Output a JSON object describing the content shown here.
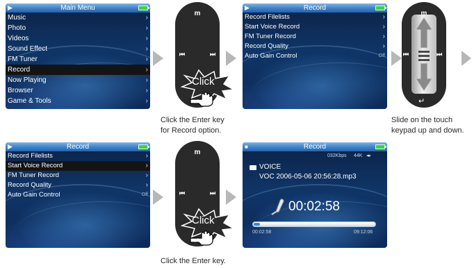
{
  "screen1": {
    "title": "Main Menu",
    "play_icon": "▶",
    "items": [
      {
        "label": "Music"
      },
      {
        "label": "Photo"
      },
      {
        "label": "Videos"
      },
      {
        "label": "Sound Effect"
      },
      {
        "label": "FM Tuner"
      },
      {
        "label": "Record"
      },
      {
        "label": "Now Playing"
      },
      {
        "label": "Browser"
      },
      {
        "label": "Game & Tools"
      }
    ],
    "selected_index": 5,
    "chevron": "›"
  },
  "screen2": {
    "title": "Record",
    "play_icon": "▶",
    "items": [
      {
        "label": "Record Filelists",
        "value": "›"
      },
      {
        "label": "Start Voice Record",
        "value": "›"
      },
      {
        "label": "FM Tuner Record",
        "value": "›"
      },
      {
        "label": "Record Quality",
        "value": "›"
      },
      {
        "label": "Auto Gain Control",
        "value": "Off"
      }
    ]
  },
  "screen3": {
    "title": "Record",
    "play_icon": "▶",
    "items": [
      {
        "label": "Record Filelists",
        "value": "›"
      },
      {
        "label": "Start Voice Record",
        "value": "›"
      },
      {
        "label": "FM Tuner Record",
        "value": "›"
      },
      {
        "label": "Record Quality",
        "value": "›"
      },
      {
        "label": "Auto Gain Control",
        "value": "Off"
      }
    ],
    "selected_index": 1
  },
  "screen4": {
    "title": "Record",
    "stop_icon": "■",
    "bitrate": "032Kbps",
    "sample_rate": "44K",
    "folder": "VOICE",
    "filename": "VOC 2006-05-06 20:56:28.mp3",
    "elapsed": "00:02:58",
    "elapsed_small": "00:02:58",
    "total": "09:12:06",
    "progress_fraction": 0.05
  },
  "remote": {
    "top_label": "m",
    "left_label": "⏮",
    "right_label": "⏭",
    "enter_glyph": "↵",
    "click_label": "Click"
  },
  "captions": {
    "enter_record": "Click the Enter key\nfor Record option.",
    "slide": "Slide on the touch\nkeypad up and down.",
    "enter": "Click the Enter key."
  },
  "colors": {
    "arrow": "#b7b7b7",
    "titlebar": "#3f84cc",
    "battery": "#3ed13e",
    "selection": "#141414"
  }
}
